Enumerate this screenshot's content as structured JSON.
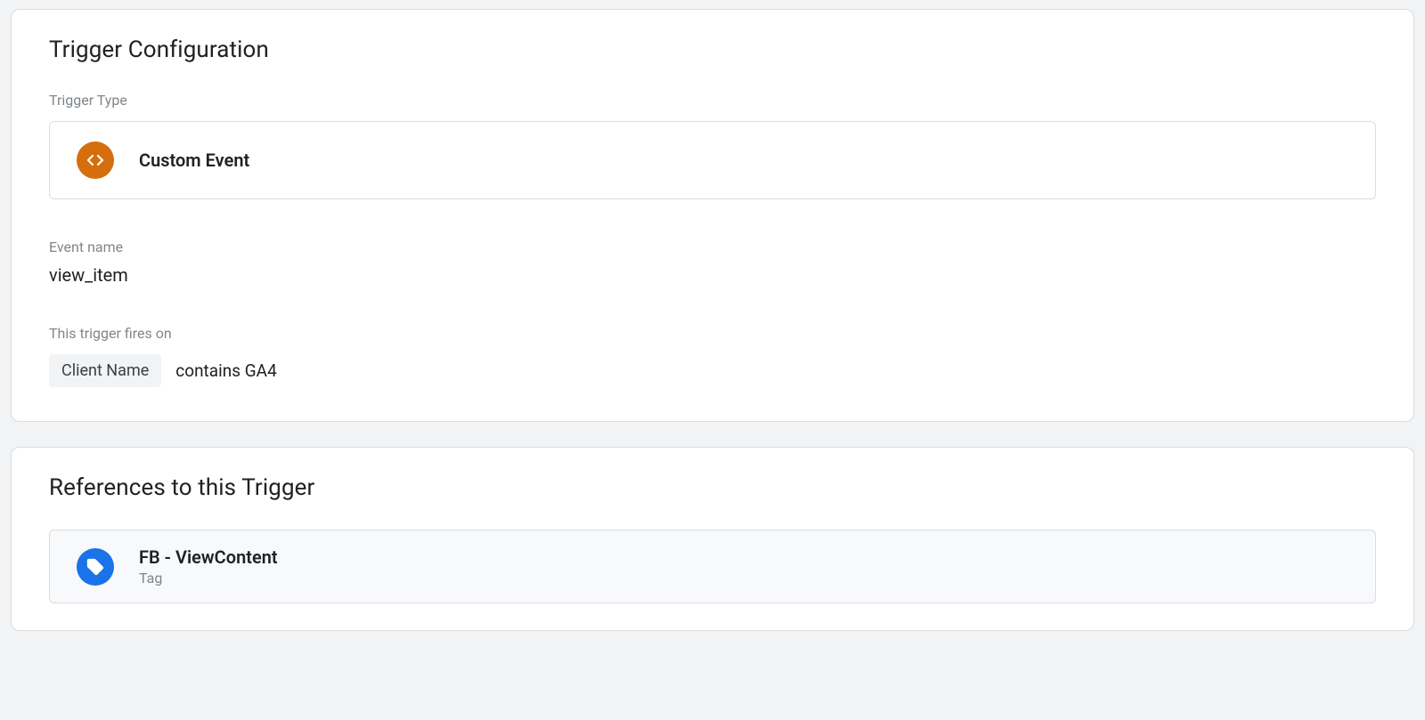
{
  "triggerConfig": {
    "title": "Trigger Configuration",
    "triggerTypeLabel": "Trigger Type",
    "triggerTypeName": "Custom Event",
    "eventNameLabel": "Event name",
    "eventNameValue": "view_item",
    "firesOnLabel": "This trigger fires on",
    "conditionVariable": "Client Name",
    "conditionText": "contains GA4"
  },
  "references": {
    "title": "References to this Trigger",
    "items": [
      {
        "name": "FB - ViewContent",
        "type": "Tag"
      }
    ]
  }
}
